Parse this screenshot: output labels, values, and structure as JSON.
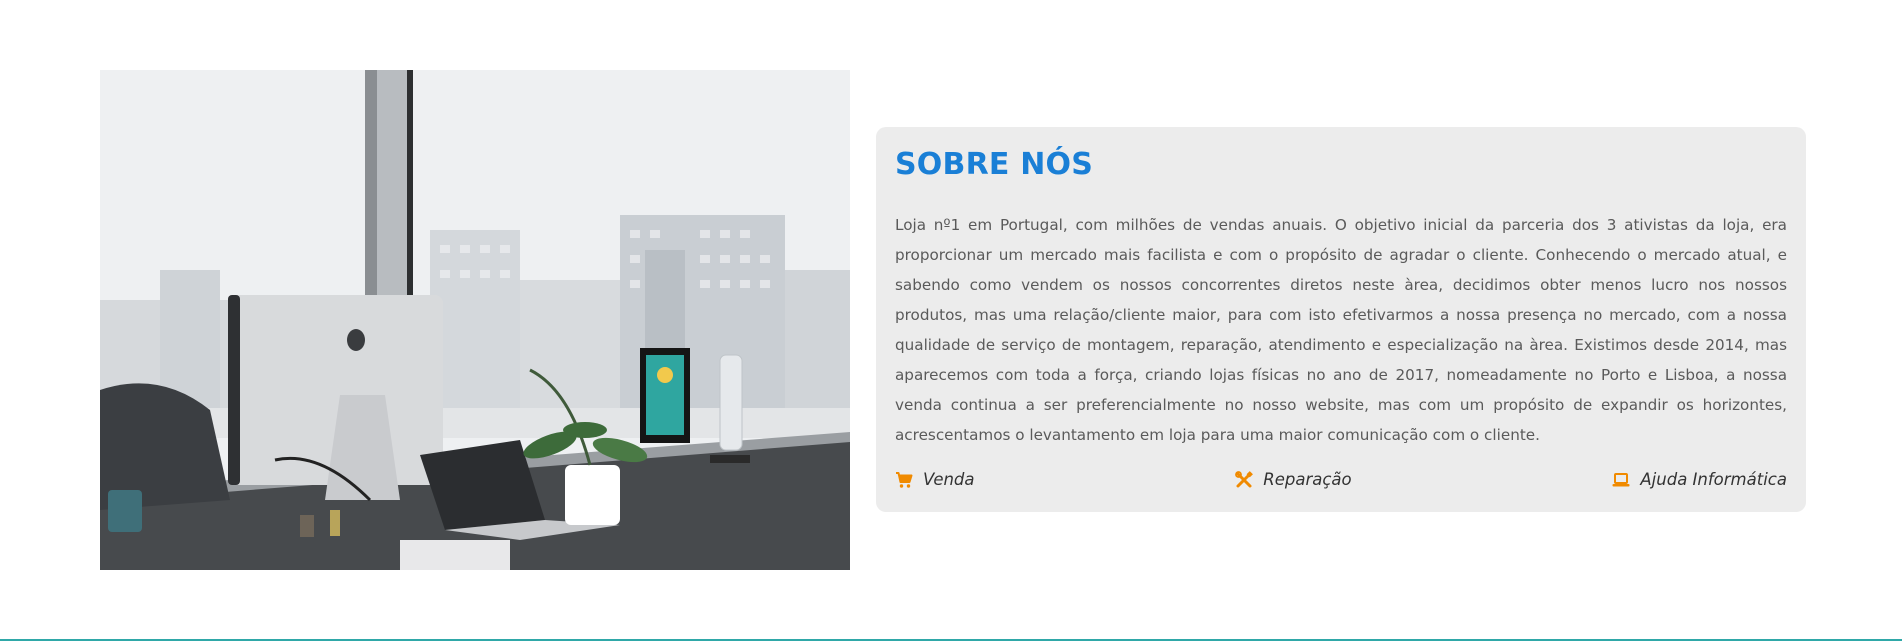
{
  "about": {
    "title": "SOBRE NÓS",
    "paragraph": "Loja nº1 em Portugal, com milhões de vendas anuais. O objetivo inicial da parceria dos 3 ativistas da loja, era proporcionar um mercado mais facilista e com o propósito de agradar o cliente. Conhecendo o mercado atual, e sabendo como vendem os nossos concorrentes diretos neste àrea, decidimos obter menos lucro nos nossos produtos, mas uma relação/cliente maior, para com isto efetivarmos a nossa presença no mercado, com a nossa qualidade de serviço de montagem, reparação, atendimento e especialização na àrea. Existimos desde 2014, mas aparecemos com toda a força, criando lojas físicas no ano de 2017, nomeadamente no Porto e Lisboa, a nossa venda continua a ser preferencialmente no nosso website, mas com um propósito de expandir os horizontes, acrescentamos o levantamento em loja para uma maior comunicação com o cliente.",
    "features": [
      {
        "label": "Venda",
        "icon": "shopping-cart-icon"
      },
      {
        "label": "Reparação",
        "icon": "tools-icon"
      },
      {
        "label": "Ajuda Informática",
        "icon": "laptop-icon"
      }
    ]
  },
  "colors": {
    "title": "#1a7fd6",
    "icon": "#f08a00",
    "card_background": "#ececec",
    "bottom_line": "#2fa8a8"
  },
  "image": {
    "icon": "office-desk-photo"
  }
}
